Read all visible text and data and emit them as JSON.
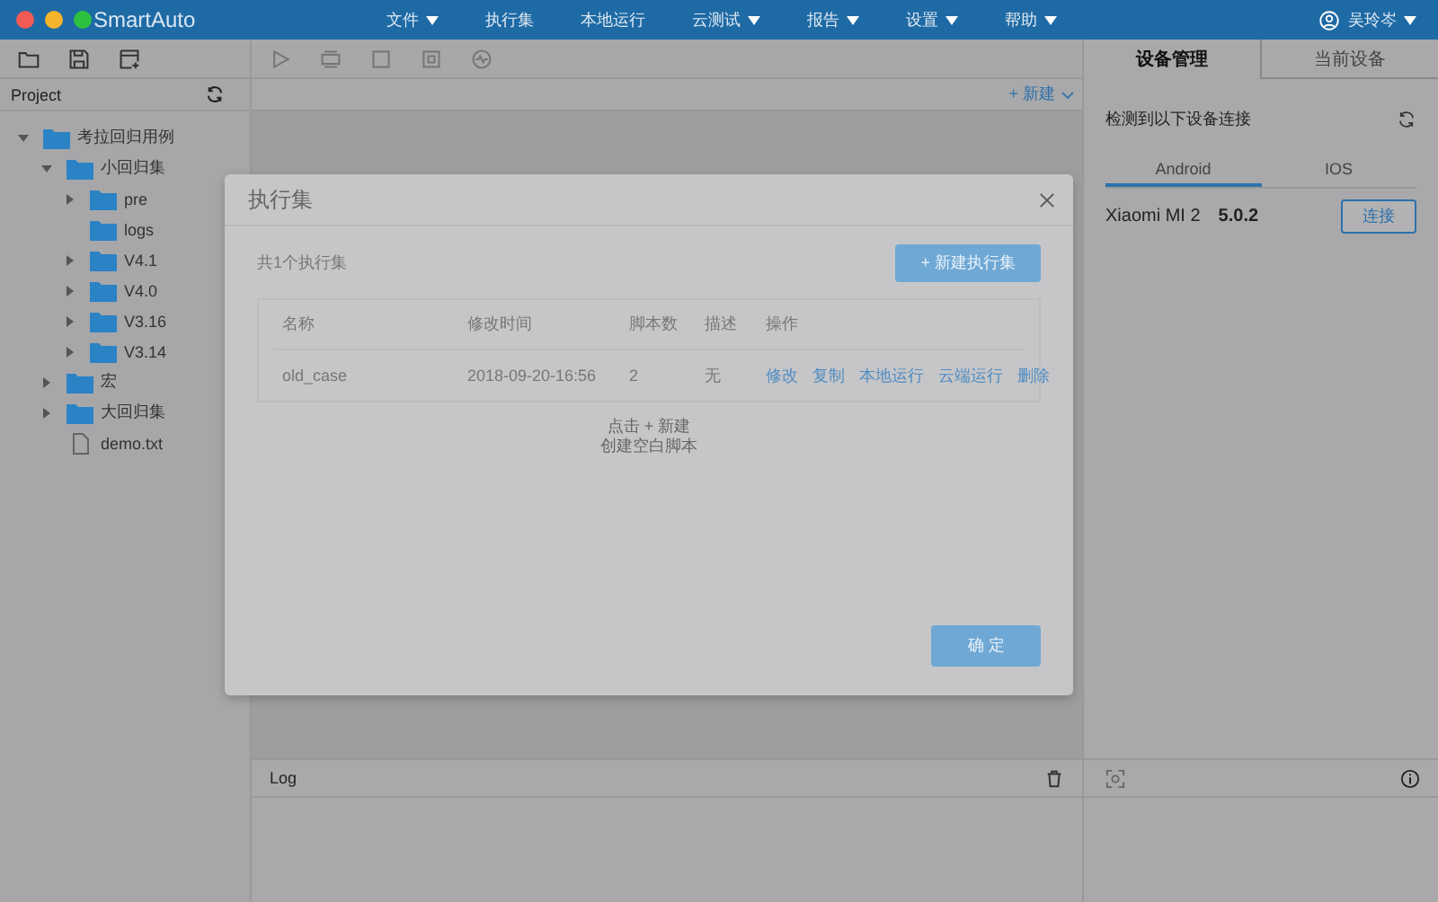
{
  "window": {
    "app_name": "SmartAuto"
  },
  "menu": [
    {
      "label": "文件",
      "dropdown": true
    },
    {
      "label": "执行集",
      "dropdown": false
    },
    {
      "label": "本地运行",
      "dropdown": false
    },
    {
      "label": "云测试",
      "dropdown": true
    },
    {
      "label": "报告",
      "dropdown": true
    },
    {
      "label": "设置",
      "dropdown": true
    },
    {
      "label": "帮助",
      "dropdown": true
    }
  ],
  "user": {
    "name": "吴玲岑"
  },
  "project": {
    "title": "Project",
    "tree": [
      {
        "label": "考拉回归用例",
        "kind": "folder",
        "expanded": true,
        "children": [
          {
            "label": "小回归集",
            "kind": "folder",
            "expanded": true,
            "children": [
              {
                "label": "pre",
                "kind": "folder",
                "expanded": false
              },
              {
                "label": "logs",
                "kind": "folder"
              },
              {
                "label": "V4.1",
                "kind": "folder",
                "expanded": false
              },
              {
                "label": "V4.0",
                "kind": "folder",
                "expanded": false
              },
              {
                "label": "V3.16",
                "kind": "folder",
                "expanded": false
              },
              {
                "label": "V3.14",
                "kind": "folder",
                "expanded": false
              }
            ]
          },
          {
            "label": "宏",
            "kind": "folder",
            "expanded": false
          },
          {
            "label": "大回归集",
            "kind": "folder",
            "expanded": false
          },
          {
            "label": "demo.txt",
            "kind": "file"
          }
        ]
      }
    ]
  },
  "editor": {
    "new_button": "+ 新建"
  },
  "log": {
    "title": "Log"
  },
  "device_panel": {
    "tabs": [
      {
        "label": "设备管理",
        "selected": true
      },
      {
        "label": "当前设备",
        "selected": false
      }
    ],
    "detect_text": "检测到以下设备连接",
    "os_tabs": [
      {
        "label": "Android",
        "selected": true
      },
      {
        "label": "IOS",
        "selected": false
      }
    ],
    "devices": [
      {
        "name": "Xiaomi MI 2",
        "version": "5.0.2",
        "action": "连接"
      }
    ]
  },
  "modal": {
    "title": "执行集",
    "count": "共1个执行集",
    "new_button": "+ 新建执行集",
    "columns": [
      "名称",
      "修改时间",
      "脚本数",
      "描述",
      "操作"
    ],
    "rows": [
      {
        "cells": [
          "old_case",
          "2018-09-20-16:56",
          "2",
          "无"
        ],
        "actions": [
          "修改",
          "复制",
          "本地运行",
          "云端运行",
          "删除"
        ]
      }
    ],
    "empty_hint": [
      "点击 + 新建",
      "创建空白脚本"
    ],
    "ok_button": "确 定"
  }
}
